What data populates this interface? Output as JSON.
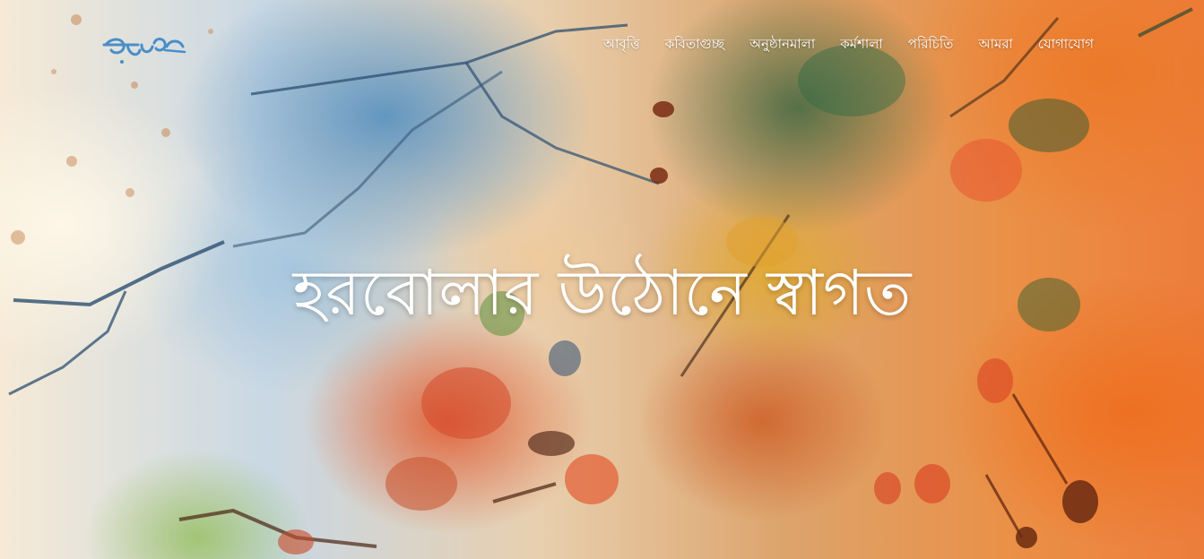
{
  "brand": {
    "logo_text": "হরবোলা",
    "logo_color": "#4a8ec8"
  },
  "nav": {
    "items": [
      {
        "label": "আবৃত্তি"
      },
      {
        "label": "কবিতাগুচ্ছ"
      },
      {
        "label": "অনুষ্ঠানমালা"
      },
      {
        "label": "কর্মশালা"
      },
      {
        "label": "পরিচিতি"
      },
      {
        "label": "আমরা"
      },
      {
        "label": "যোগাযোগ"
      }
    ]
  },
  "hero": {
    "headline": "হরবোলার উঠোনে স্বাগত",
    "text_color": "#ffffff"
  }
}
